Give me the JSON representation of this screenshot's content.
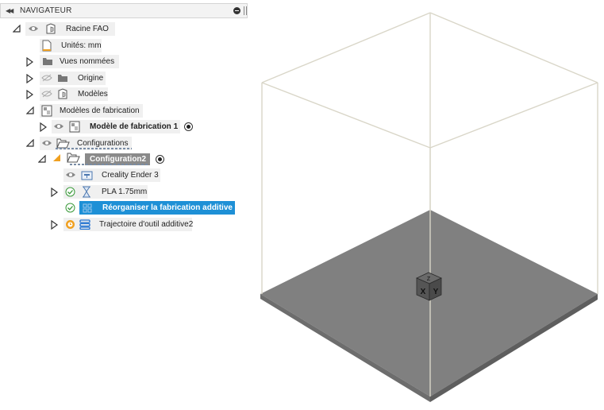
{
  "navigator": {
    "title": "NAVIGATEUR",
    "items": {
      "root": "Racine FAO",
      "units": "Unités: mm",
      "named_views": "Vues nommées",
      "origin": "Origine",
      "models": "Modèles",
      "manufacturing_models": "Modèles de fabrication",
      "manufacturing_model_1": "Modèle de fabrication 1",
      "configurations": "Configurations",
      "configuration2": "Configuration2",
      "machine": "Creality Ender 3",
      "material": "PLA 1.75mm",
      "arrange": "Réorganiser la fabrication additive",
      "toolpath": "Trajectoire d'outil additive2"
    }
  },
  "viewcube": {
    "faces": [
      "Z",
      "X",
      "Y"
    ]
  },
  "colors": {
    "selection": "#1e90d6",
    "build_plate": "#808080",
    "build_volume_edges": "#d9d6c8",
    "check_green": "#3a9a3a",
    "toolpath_orange": "#f0a020",
    "toolpath_icon_blue": "#1e6fd0"
  }
}
